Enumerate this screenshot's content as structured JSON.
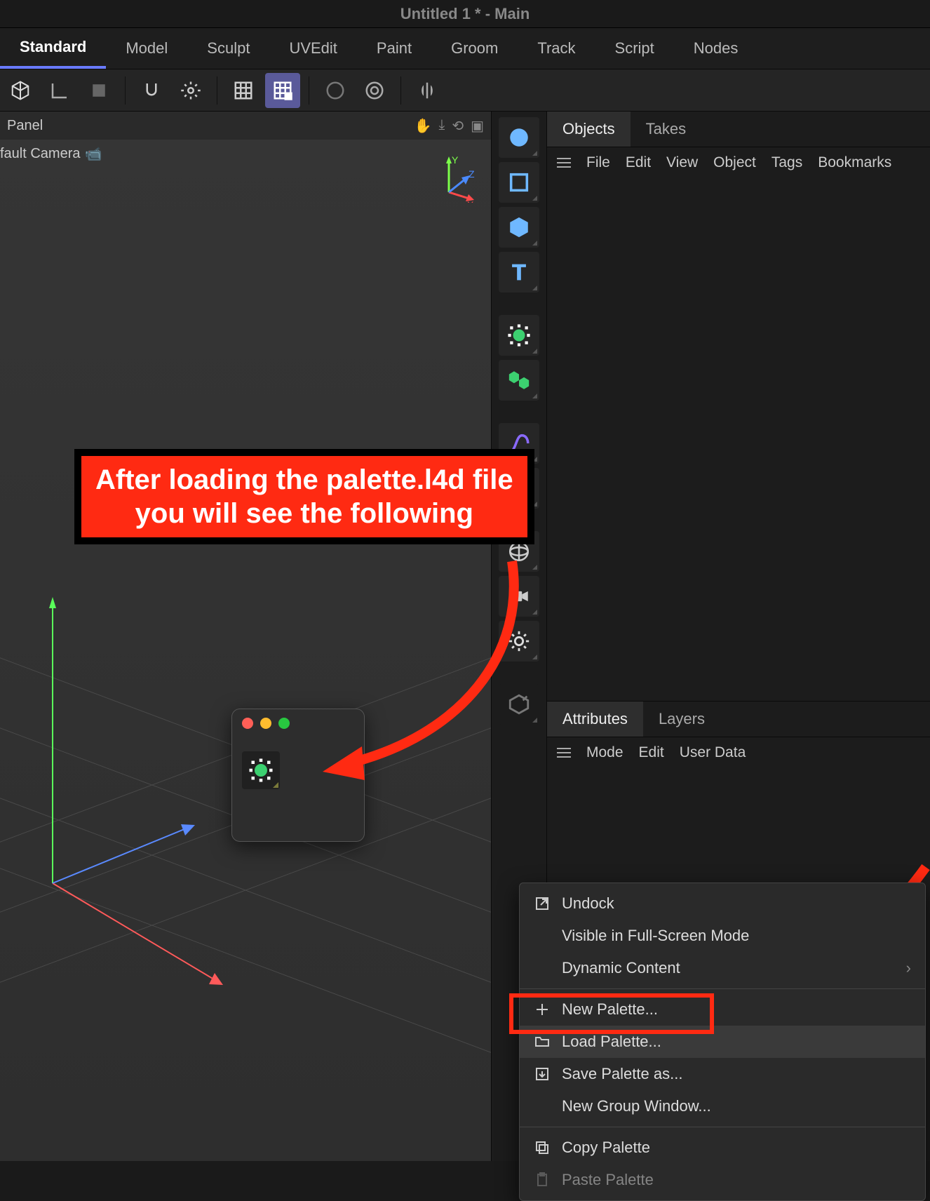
{
  "window": {
    "title": "Untitled 1 * - Main"
  },
  "layouts": [
    "Standard",
    "Model",
    "Sculpt",
    "UVEdit",
    "Paint",
    "Groom",
    "Track",
    "Script",
    "Nodes"
  ],
  "active_layout": "Standard",
  "panel_label": "Panel",
  "camera_label": "fault Camera",
  "right_panel": {
    "tabs_top": [
      "Objects",
      "Takes"
    ],
    "active_top": "Objects",
    "menu_top": [
      "File",
      "Edit",
      "View",
      "Object",
      "Tags",
      "Bookmarks"
    ],
    "tabs_bottom": [
      "Attributes",
      "Layers"
    ],
    "active_bottom": "Attributes",
    "menu_bottom": [
      "Mode",
      "Edit",
      "User Data"
    ]
  },
  "context_menu": {
    "undock": "Undock",
    "fullscreen": "Visible in Full-Screen Mode",
    "dynamic": "Dynamic Content",
    "new_palette": "New Palette...",
    "load_palette": "Load Palette...",
    "save_palette": "Save Palette as...",
    "new_group": "New Group Window...",
    "copy_palette": "Copy Palette",
    "paste_palette": "Paste Palette"
  },
  "callout": {
    "line1": "After loading the palette.l4d file",
    "line2": "you will see the following"
  }
}
